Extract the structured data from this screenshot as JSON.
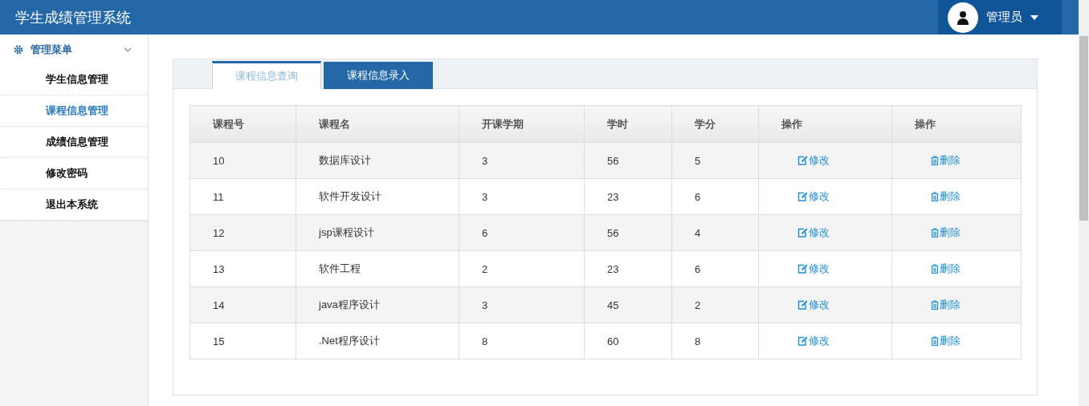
{
  "header": {
    "title": "学生成绩管理系统",
    "user": "管理员"
  },
  "sidebar": {
    "menu": {
      "label": "管理菜单",
      "expanded": true
    },
    "items": [
      {
        "label": "学生信息管理",
        "selected": false
      },
      {
        "label": "课程信息管理",
        "selected": true
      },
      {
        "label": "成绩信息管理",
        "selected": false
      },
      {
        "label": "修改密码",
        "selected": false
      },
      {
        "label": "退出本系统",
        "selected": false
      }
    ]
  },
  "tabs": [
    {
      "label": "课程信息查询",
      "selected": true
    },
    {
      "label": "课程信息录入",
      "selected": false
    }
  ],
  "table": {
    "columns": [
      "课程号",
      "课程名",
      "开课学期",
      "学时",
      "学分",
      "操作",
      "操作"
    ],
    "rows": [
      {
        "cells": [
          "10",
          "数据库设计",
          "3",
          "56",
          "5"
        ],
        "edit": "修改",
        "delete": "删除"
      },
      {
        "cells": [
          "11",
          "软件开发设计",
          "3",
          "23",
          "6"
        ],
        "edit": "修改",
        "delete": "删除"
      },
      {
        "cells": [
          "12",
          "jsp课程设计",
          "6",
          "56",
          "4"
        ],
        "edit": "修改",
        "delete": "删除"
      },
      {
        "cells": [
          "13",
          "软件工程",
          "2",
          "23",
          "6"
        ],
        "edit": "修改",
        "delete": "删除"
      },
      {
        "cells": [
          "14",
          "java程序设计",
          "3",
          "45",
          "2"
        ],
        "edit": "修改",
        "delete": "删除"
      },
      {
        "cells": [
          "15",
          ".Net程序设计",
          "8",
          "60",
          "8"
        ],
        "edit": "修改",
        "delete": "删除"
      }
    ]
  }
}
